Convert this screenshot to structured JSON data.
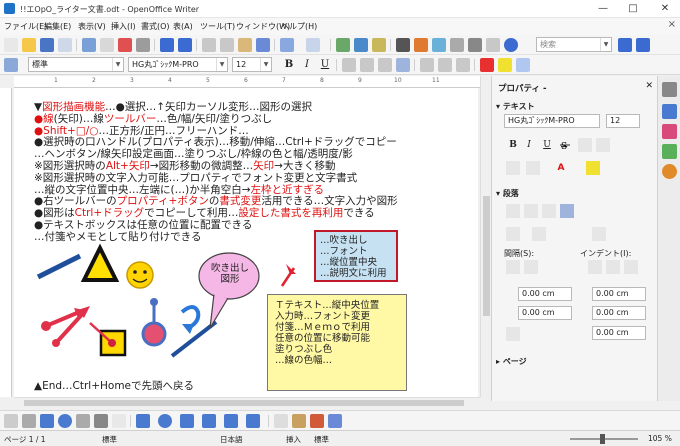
{
  "window": {
    "title": "!!エOpO_ライター文書.odt - OpenOffice Writer",
    "minimize": "—",
    "maximize": "□",
    "close": "✕"
  },
  "menu": [
    "ファイル(E)",
    "編集(E)",
    "表示(V)",
    "挿入(I)",
    "書式(O)",
    "表(A)",
    "ツール(T)",
    "ウィンドウ(W)",
    "ヘルプ(H)"
  ],
  "menu_close_doc": "×",
  "toolbar": {
    "search_placeholder": "検索",
    "paragraph_style": "標準",
    "font_name": "HG丸ｺﾞｼｯｸM-PRO",
    "font_size": "12",
    "bold": "B",
    "italic": "I",
    "underline": "U"
  },
  "document": {
    "lines": [
      {
        "parts": [
          {
            "t": "▼",
            "c": ""
          },
          {
            "t": "図形描画機能",
            "c": "red"
          },
          {
            "t": "…●選択…↑矢印カーソル変形…図形の選択",
            "c": ""
          }
        ]
      },
      {
        "parts": [
          {
            "t": "●",
            "c": "red"
          },
          {
            "t": "線",
            "c": "red"
          },
          {
            "t": "(矢印)…線",
            "c": ""
          },
          {
            "t": "ツールバー",
            "c": "red"
          },
          {
            "t": "…色/幅/矢印/塗りつぶし",
            "c": ""
          }
        ]
      },
      {
        "parts": [
          {
            "t": "●",
            "c": "red"
          },
          {
            "t": "Shift+□/○",
            "c": "red"
          },
          {
            "t": "…正方形/正円…フリーハンド…",
            "c": ""
          }
        ]
      },
      {
        "parts": [
          {
            "t": "●選択時の口ハンドル(プロパティ表示)…移動/伸縮…Ctrl+ドラッグでコピー",
            "c": ""
          }
        ]
      },
      {
        "parts": [
          {
            "t": "…ヘンボタン/線矢印設定画面…塗りつぶし/枠線の色と幅/透明度/影",
            "c": ""
          }
        ]
      },
      {
        "parts": [
          {
            "t": "※図形選択時の",
            "c": ""
          },
          {
            "t": "Alt+矢印",
            "c": "red"
          },
          {
            "t": "→図形移動の微調整…",
            "c": ""
          },
          {
            "t": "矢印",
            "c": "red"
          },
          {
            "t": "→大きく移動",
            "c": ""
          }
        ]
      },
      {
        "parts": [
          {
            "t": "※図形選択時の文字入力可能…プロパティでフォント変更と文字書式",
            "c": ""
          }
        ]
      },
      {
        "parts": [
          {
            "t": "…縦の文字位置中央…左端に(…)か半角空白→",
            "c": ""
          },
          {
            "t": "左枠と近すぎる",
            "c": "red"
          }
        ]
      },
      {
        "parts": [
          {
            "t": "●右ツールバーの",
            "c": ""
          },
          {
            "t": "プロパティ+ボタン",
            "c": "red"
          },
          {
            "t": "の",
            "c": ""
          },
          {
            "t": "書式変更",
            "c": "red"
          },
          {
            "t": "活用できる…文字入力や図形",
            "c": ""
          }
        ]
      },
      {
        "parts": [
          {
            "t": "●図形は",
            "c": ""
          },
          {
            "t": "Ctrl+ドラッグ",
            "c": "red"
          },
          {
            "t": "でコピーして利用…",
            "c": ""
          },
          {
            "t": "設定した書式を再利用",
            "c": "red"
          },
          {
            "t": "できる",
            "c": ""
          }
        ]
      },
      {
        "parts": [
          {
            "t": "●テキストボックスは任意の位置に配置できる",
            "c": ""
          }
        ]
      },
      {
        "parts": [
          {
            "t": "…付箋やメモとして貼り付けできる",
            "c": ""
          }
        ]
      }
    ],
    "callout_lines": [
      "…吹き出し",
      "…フォント",
      "…縦位置中央",
      "…説明文に利用"
    ],
    "bubble_lines": [
      "吹き出し",
      "図形"
    ],
    "yellow_lines": [
      "Ｔテキスト…縦中央位置",
      "入力時…フォント変更",
      "付箋…Ｍｅｍｏで利用",
      "任意の位置に移動可能",
      "塗りつぶし色",
      "…線の色幅…"
    ],
    "end_line": "▲End…Ctrl+Homeで先頭へ戻る"
  },
  "sidebar": {
    "title": "プロパティ -",
    "text_section": "テキスト",
    "font_name": "HG丸ｺﾞｼｯｸM-PRO",
    "font_size": "12",
    "paragraph_section": "段落",
    "spacing_label": "間隔(S):",
    "indent_label": "インデント(I):",
    "spacing_above": "0.00 cm",
    "spacing_below": "0.00 cm",
    "indent_before": "0.00 cm",
    "indent_after": "0.00 cm",
    "indent_first": "0.00 cm",
    "page_section": "ページ"
  },
  "status": {
    "page": "ページ 1 / 1",
    "style": "標準",
    "language": "日本語",
    "insert": "挿入",
    "mode": "標準",
    "zoom": "105 %"
  },
  "colors": {
    "red_text": "#e01010",
    "callout_fill": "#c5e1f2",
    "callout_border": "#c01828",
    "yellow_fill": "#fff8a4",
    "bubble_fill": "#f4b7e6",
    "triangle_fill": "#ffe000",
    "smiley_fill": "#ffd400",
    "arrow_color": "#e0304a",
    "blue_line": "#1f4f9a"
  }
}
